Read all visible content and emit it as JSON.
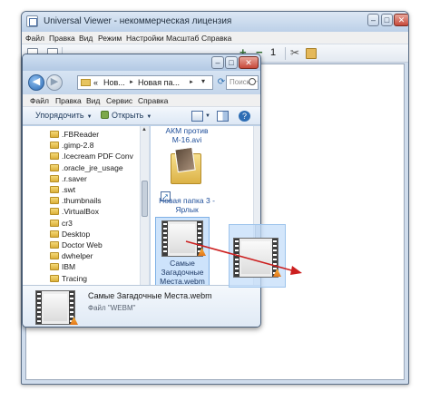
{
  "app": {
    "title": "Universal Viewer - некоммерческая лицензия",
    "menu": [
      "Файл",
      "Правка",
      "Вид",
      "Режим",
      "Настройки",
      "Масштаб",
      "Справка"
    ]
  },
  "explorer": {
    "address": {
      "prefix": "«",
      "crumbs": [
        "Нов...",
        "Новая па..."
      ],
      "separator": "►"
    },
    "search_placeholder": "Поиск: Н...",
    "menu": [
      "Файл",
      "Правка",
      "Вид",
      "Сервис",
      "Справка"
    ],
    "commands": {
      "organize": "Упорядочить",
      "open": "Открыть"
    },
    "nav_items": [
      ".FBReader",
      ".gimp-2.8",
      ".Icecream PDF Conv",
      ".oracle_jre_usage",
      ".r.saver",
      ".swt",
      ".thumbnails",
      ".VirtualBox",
      "cr3",
      "Desktop",
      "Doctor Web",
      "dwhelper",
      "IBM",
      "Tracing"
    ],
    "files": {
      "akm_label_line1": "АКМ против",
      "akm_label_line2": "М-16.avi",
      "shortcut_label_line1": "Новая папка 3 -",
      "shortcut_label_line2": "Ярлык",
      "webm_label_line1": "Самые",
      "webm_label_line2": "Загадочные",
      "webm_label_line3": "Места.webm"
    },
    "details": {
      "name": "Самые Загадочные Места.webm",
      "type": "Файл \"WEBM\""
    }
  },
  "colors": {
    "accent": "#2c6ab3",
    "selection": "#cde3fb",
    "drag_arrow": "#cc1f1f"
  },
  "icons": [
    "back-arrow-icon",
    "forward-arrow-icon",
    "folder-icon",
    "search-icon",
    "refresh-icon",
    "help-icon",
    "video-file-icon",
    "vlc-cone-icon",
    "shortcut-arrow-icon"
  ]
}
